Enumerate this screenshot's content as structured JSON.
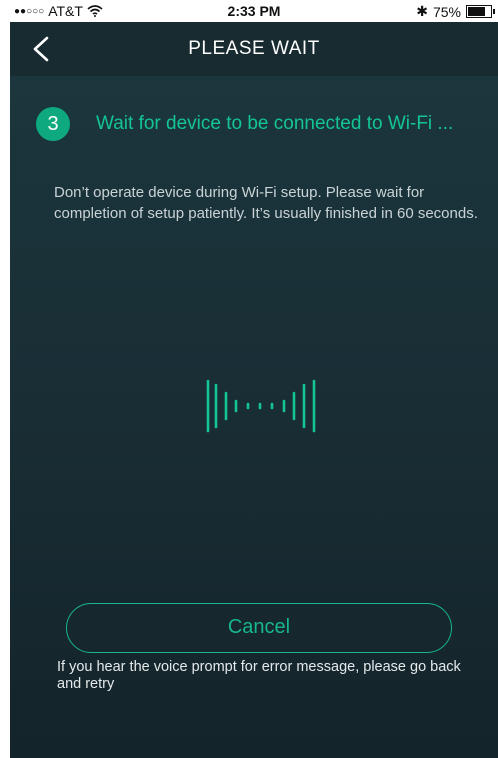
{
  "status_bar": {
    "signal": "●●○○○",
    "carrier": "AT&T",
    "time": "2:33 PM",
    "bluetooth": "✱",
    "battery_percent": "75%",
    "battery_level": 0.75
  },
  "navbar": {
    "back_icon": "chevron-left-icon",
    "title": "PLEASE WAIT"
  },
  "step": {
    "number": "3",
    "title": "Wait for device to be connected to Wi-Fi ...",
    "description": "Don’t operate device during Wi-Fi setup. Please wait for completion of setup patiently. It’s usually finished in 60 seconds."
  },
  "animation_icon": "sound-wave-icon",
  "cancel_label": "Cancel",
  "hint": "If you hear the voice prompt for error message, please go back and retry",
  "colors": {
    "accent": "#14c593",
    "badge": "#0ea97f",
    "background": "#1a3138"
  }
}
